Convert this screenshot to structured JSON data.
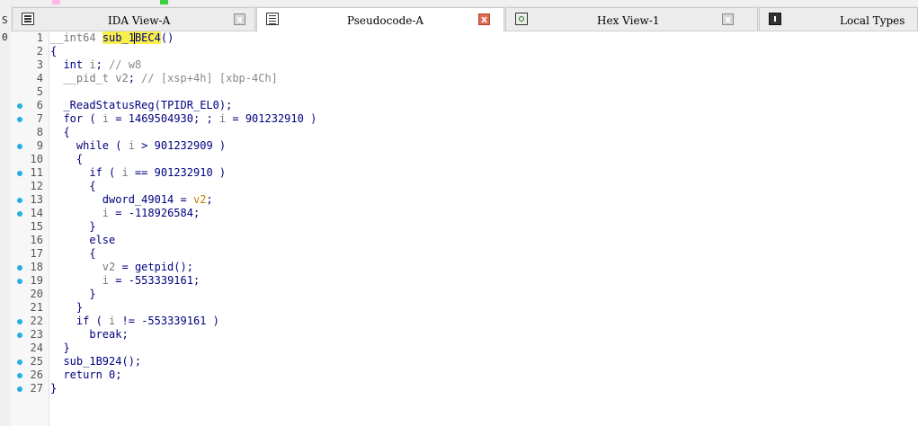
{
  "tabs": [
    {
      "label": "IDA View-A",
      "icon": "code-listing-icon",
      "active": false,
      "close": "x"
    },
    {
      "label": "Pseudocode-A",
      "icon": "list-icon",
      "active": true,
      "close": "x"
    },
    {
      "label": "Hex View-1",
      "icon": "hex-view-icon",
      "active": false,
      "close": "x"
    },
    {
      "label": "Local Types",
      "icon": "info-icon",
      "active": false
    }
  ],
  "left_strip": [
    "S",
    "0"
  ],
  "colors": {
    "keyword": "#000080",
    "comment": "#8a8a8a",
    "highlight": "#f7f04a",
    "breakpoint_dot": "#27aee6",
    "close_hot": "#e06b55"
  },
  "code": {
    "function_name": "sub_1BEC4",
    "lines": [
      {
        "n": "1",
        "dot": false,
        "text": "__int64 sub_1BEC4()"
      },
      {
        "n": "2",
        "dot": false,
        "text": "{"
      },
      {
        "n": "3",
        "dot": false,
        "text": "  int i; // w8"
      },
      {
        "n": "4",
        "dot": false,
        "text": "  __pid_t v2; // [xsp+4h] [xbp-4Ch]"
      },
      {
        "n": "5",
        "dot": false,
        "text": ""
      },
      {
        "n": "6",
        "dot": true,
        "text": "  _ReadStatusReg(TPIDR_EL0);"
      },
      {
        "n": "7",
        "dot": true,
        "text": "  for ( i = 1469504930; ; i = 901232910 )"
      },
      {
        "n": "8",
        "dot": false,
        "text": "  {"
      },
      {
        "n": "9",
        "dot": true,
        "text": "    while ( i > 901232909 )"
      },
      {
        "n": "10",
        "dot": false,
        "text": "    {"
      },
      {
        "n": "11",
        "dot": true,
        "text": "      if ( i == 901232910 )"
      },
      {
        "n": "12",
        "dot": false,
        "text": "      {"
      },
      {
        "n": "13",
        "dot": true,
        "text": "        dword_49014 = v2;"
      },
      {
        "n": "14",
        "dot": true,
        "text": "        i = -118926584;"
      },
      {
        "n": "15",
        "dot": false,
        "text": "      }"
      },
      {
        "n": "16",
        "dot": false,
        "text": "      else"
      },
      {
        "n": "17",
        "dot": false,
        "text": "      {"
      },
      {
        "n": "18",
        "dot": true,
        "text": "        v2 = getpid();"
      },
      {
        "n": "19",
        "dot": true,
        "text": "        i = -553339161;"
      },
      {
        "n": "20",
        "dot": false,
        "text": "      }"
      },
      {
        "n": "21",
        "dot": false,
        "text": "    }"
      },
      {
        "n": "22",
        "dot": true,
        "text": "    if ( i != -553339161 )"
      },
      {
        "n": "23",
        "dot": true,
        "text": "      break;"
      },
      {
        "n": "24",
        "dot": false,
        "text": "  }"
      },
      {
        "n": "25",
        "dot": true,
        "text": "  sub_1B924();"
      },
      {
        "n": "26",
        "dot": true,
        "text": "  return 0;"
      },
      {
        "n": "27",
        "dot": true,
        "text": "}"
      }
    ]
  }
}
